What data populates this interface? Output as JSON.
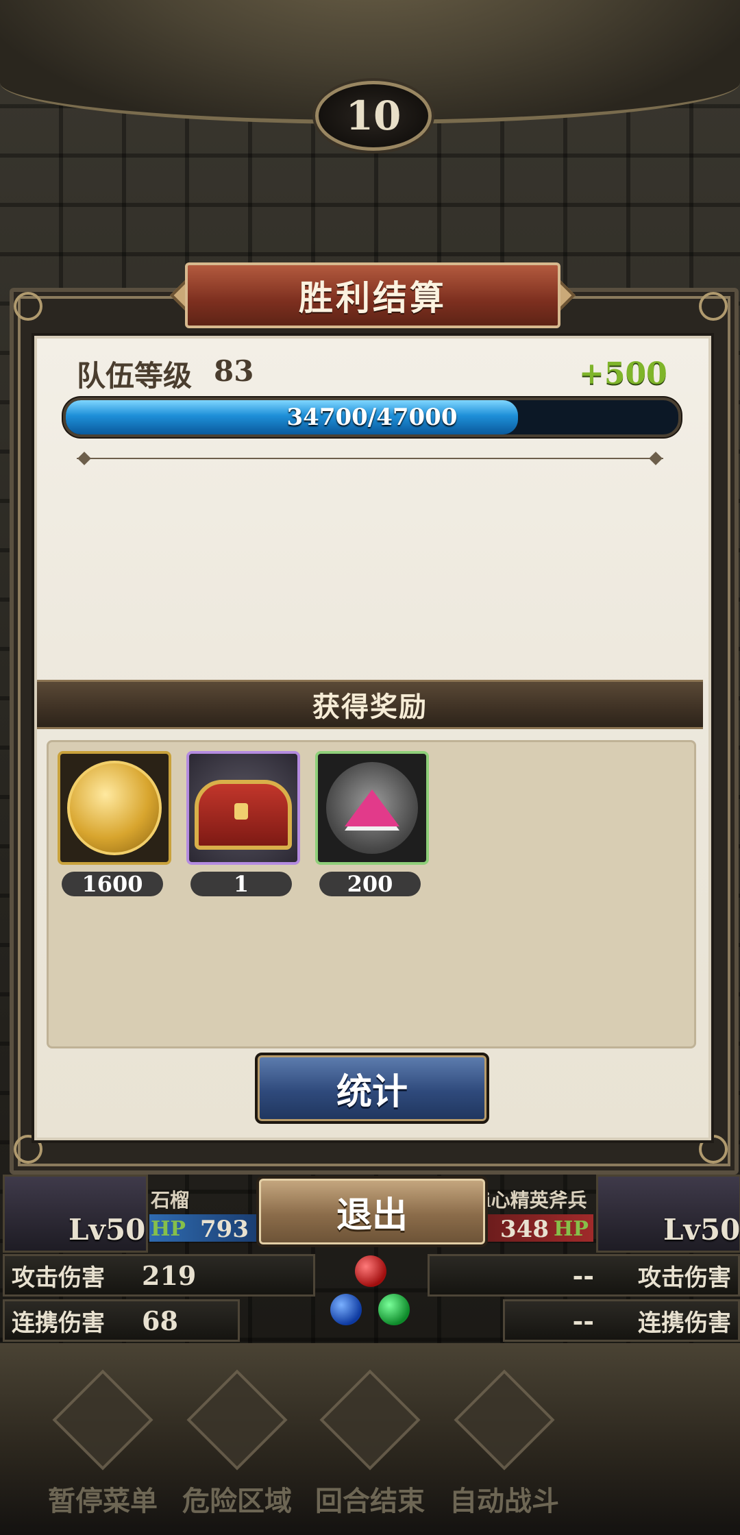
{
  "turn": "10",
  "dialog": {
    "title": "胜利结算",
    "team_level_label": "队伍等级",
    "team_level": "83",
    "exp_gain": "+500",
    "exp_text": "34700/47000",
    "exp_fraction": 0.738
  },
  "rewards": {
    "header": "获得奖励",
    "items": [
      {
        "icon": "gold-coin-icon",
        "count": "1600"
      },
      {
        "icon": "treasure-chest-icon",
        "count": "1"
      },
      {
        "icon": "pink-crystal-icon",
        "count": "200"
      }
    ]
  },
  "buttons": {
    "stats": "统计",
    "exit": "退出"
  },
  "battle": {
    "left_unit": {
      "level": "Lv50",
      "name": "石榴",
      "hp_label": "HP",
      "hp": "793"
    },
    "right_unit": {
      "level": "Lv50",
      "name": "i心精英斧兵",
      "hp_label": "HP",
      "hp": "348"
    },
    "left_attack_label": "攻击伤害",
    "left_attack_value": "219",
    "left_combo_label": "连携伤害",
    "left_combo_value": "68",
    "right_attack_label": "攻击伤害",
    "right_attack_value": "--",
    "right_combo_label": "连携伤害",
    "right_combo_value": "--"
  },
  "menu": {
    "pause": "暂停菜单",
    "danger": "危险区域",
    "end_turn": "回合结束",
    "auto": "自动战斗"
  }
}
